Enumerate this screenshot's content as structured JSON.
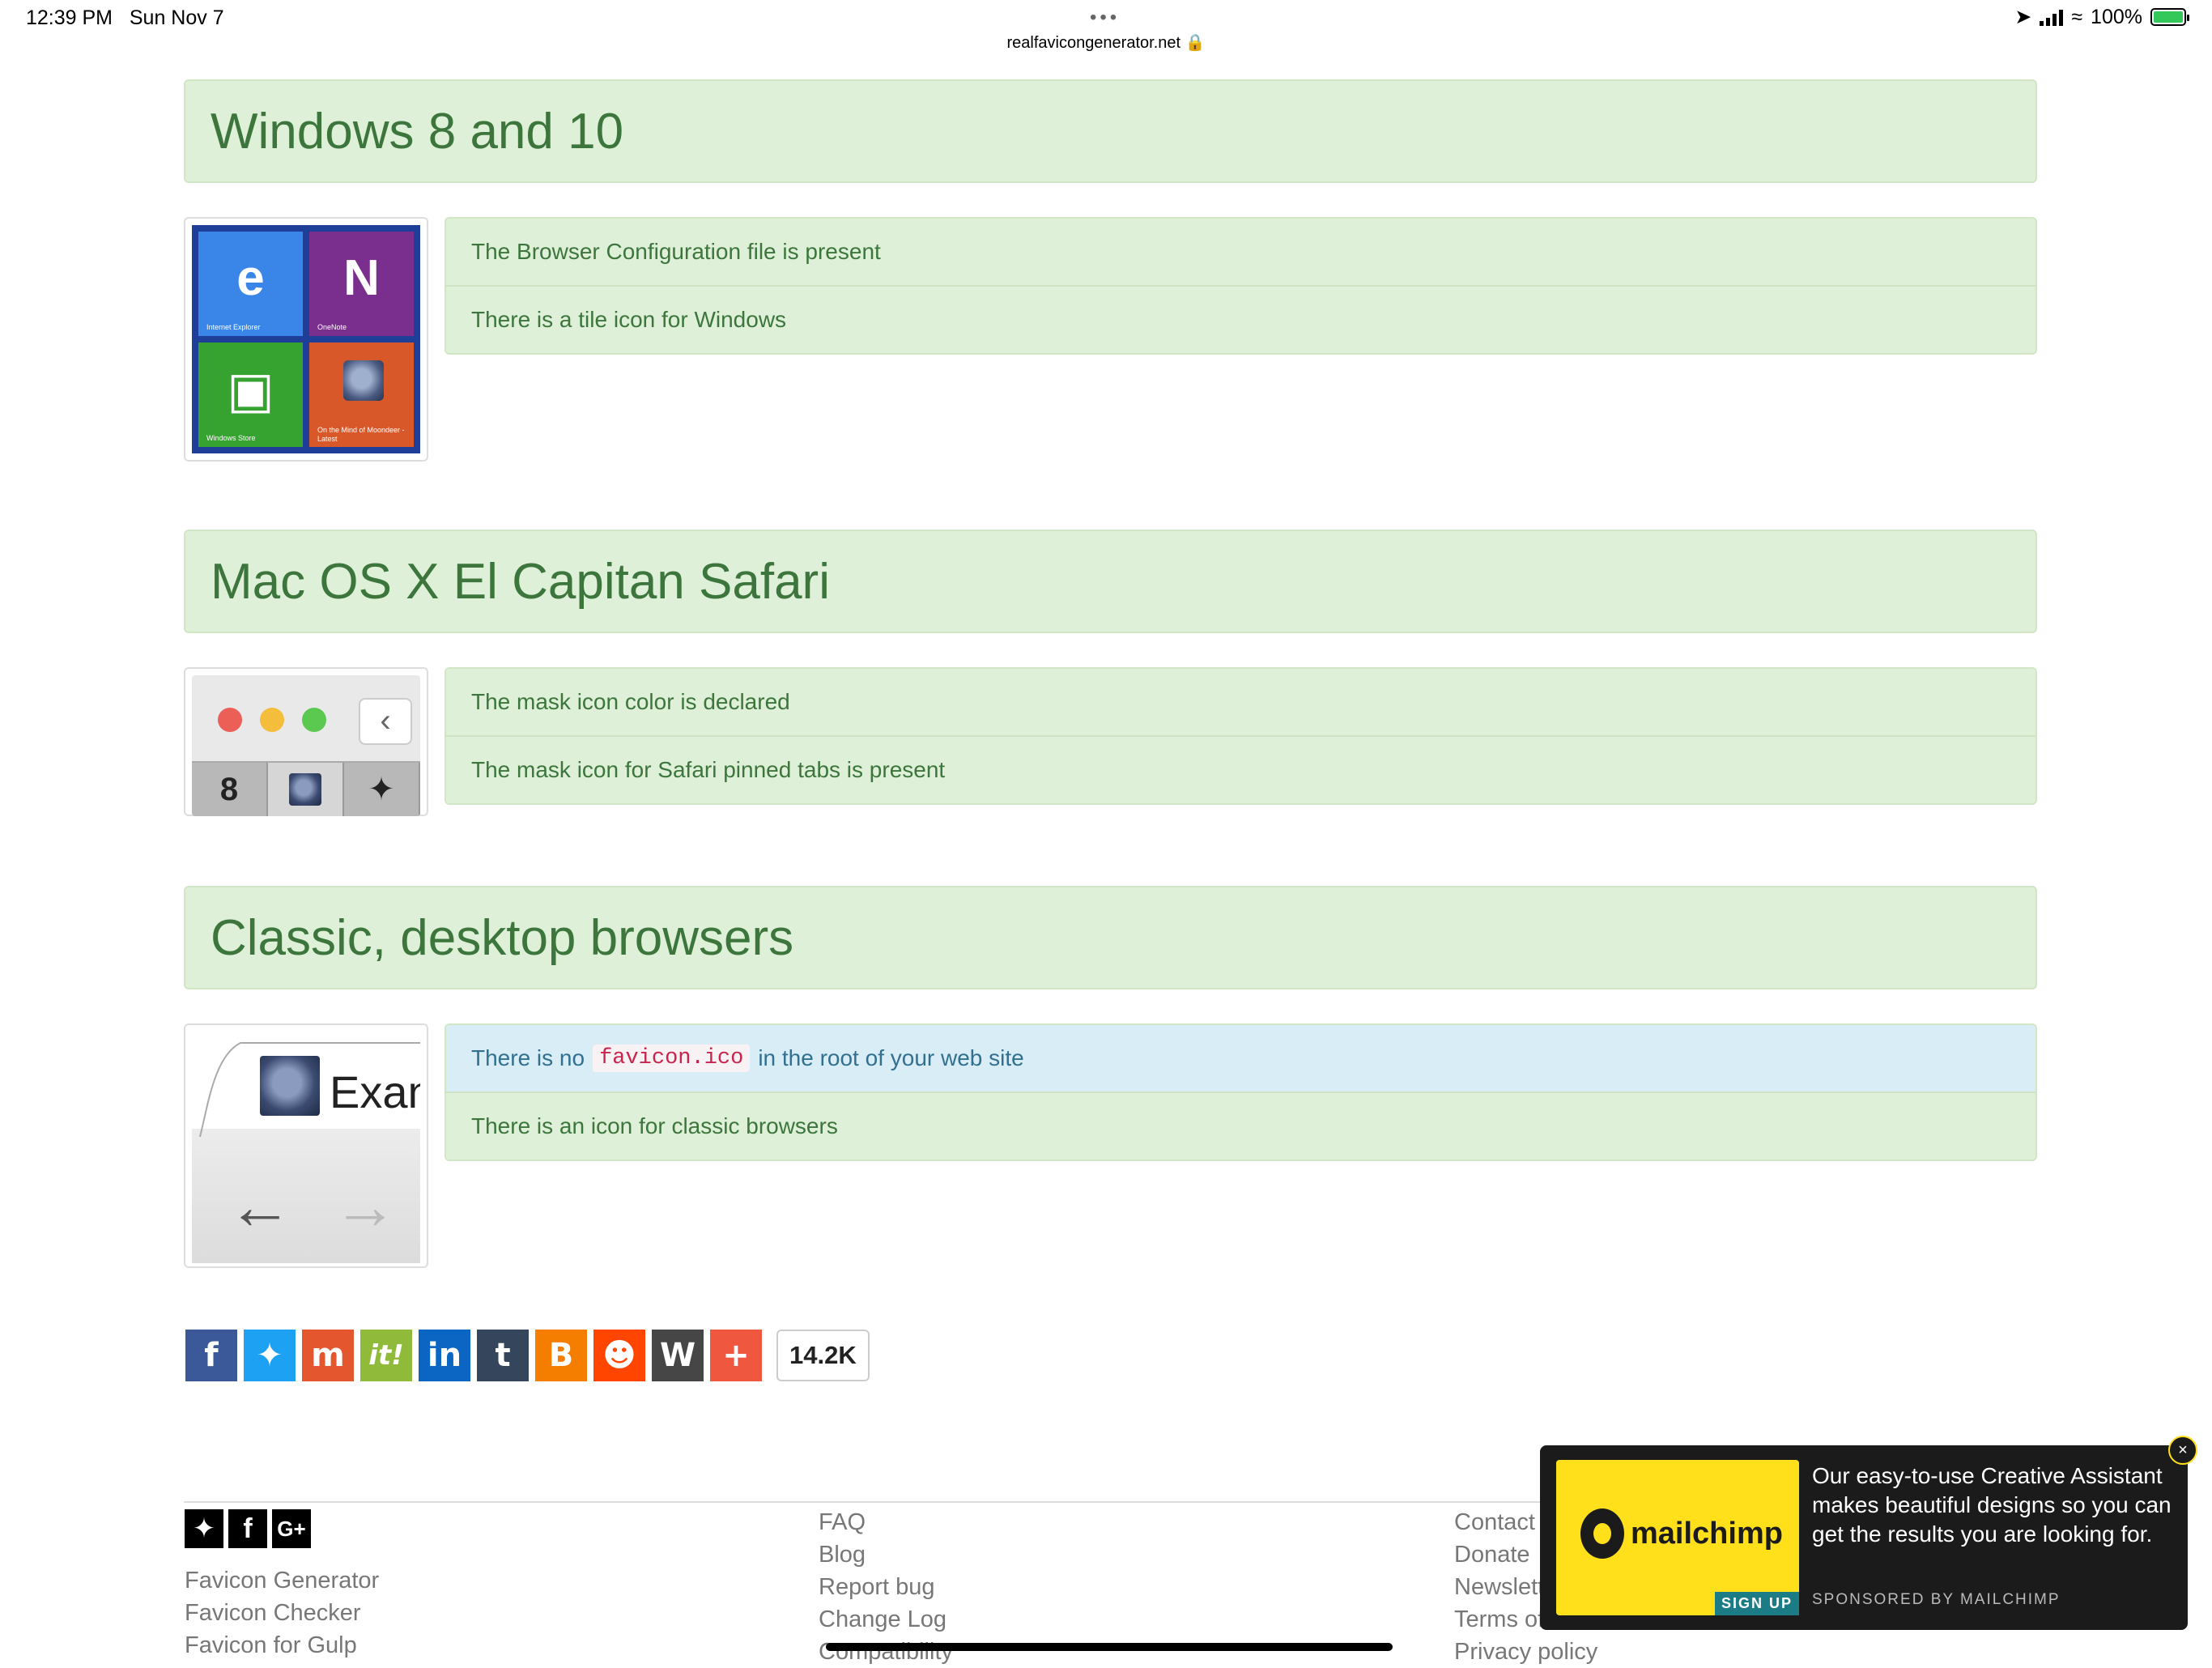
{
  "status_bar": {
    "time": "12:39 PM",
    "date": "Sun Nov 7",
    "dots": "•••",
    "url": "realfavicongenerator.net",
    "battery": "100%"
  },
  "sections": [
    {
      "title": "Windows 8 and 10",
      "checks": [
        "The Browser Configuration file is present",
        "There is a tile icon for Windows"
      ],
      "tiles": [
        "Internet Explorer",
        "OneNote",
        "Windows Store",
        "On the Mind of Moondeer - Latest"
      ]
    },
    {
      "title": "Mac OS X El Capitan Safari",
      "checks": [
        "The mask icon color is declared",
        "The mask icon for Safari pinned tabs is present"
      ]
    },
    {
      "title": "Classic, desktop browsers",
      "check_info": {
        "before": "There is no",
        "code": "favicon.ico",
        "after": "in the root of your web site"
      },
      "checks": [
        "There is an icon for classic browsers"
      ],
      "tab_text": "Exan"
    }
  ],
  "share": {
    "buttons": [
      "facebook",
      "twitter",
      "mix",
      "scoop-it",
      "linkedin",
      "tumblr",
      "blogger",
      "reddit",
      "wordpress",
      "more"
    ],
    "count": "14.2K"
  },
  "footer": {
    "col1": [
      "Favicon Generator",
      "Favicon Checker",
      "Favicon for Gulp"
    ],
    "col2": [
      "FAQ",
      "Blog",
      "Report bug",
      "Change Log",
      "Compatibility"
    ],
    "col3": [
      "Contact",
      "Donate",
      "Newslett",
      "Terms of",
      "Privacy policy"
    ]
  },
  "ad": {
    "brand": "mailchimp",
    "text": "Our easy-to-use Creative Assistant makes beautiful designs so you can get the results you are looking for.",
    "signup": "SIGN UP",
    "sponsor": "SPONSORED BY MAILCHIMP",
    "close": "×"
  },
  "colors": {
    "success_bg": "#dff0d8",
    "success_text": "#3c763d",
    "info_bg": "#d9edf7",
    "info_text": "#31708f"
  }
}
